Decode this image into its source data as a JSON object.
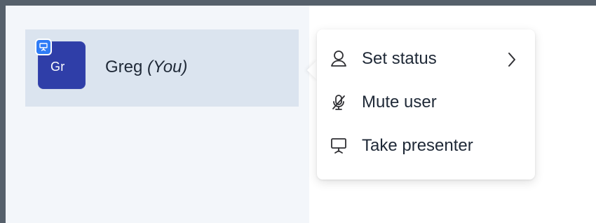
{
  "user": {
    "initials": "Gr",
    "name": "Greg",
    "you_label": "(You)"
  },
  "menu": {
    "items": [
      {
        "label": "Set status",
        "icon": "user-icon",
        "has_submenu": true
      },
      {
        "label": "Mute user",
        "icon": "microphone-off-icon",
        "has_submenu": false
      },
      {
        "label": "Take presenter",
        "icon": "presentation-icon",
        "has_submenu": false
      }
    ]
  },
  "colors": {
    "frame": "#56606b",
    "sidebar_background": "#f3f6fa",
    "selected_row": "#dbe4ef",
    "avatar": "#2f3ea8",
    "presenter_badge": "#2f7cf6",
    "menu_background": "#ffffff",
    "text": "#1f2937"
  }
}
